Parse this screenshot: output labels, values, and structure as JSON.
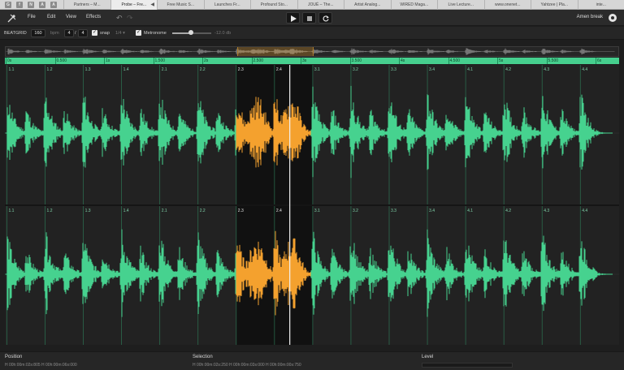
{
  "browser": {
    "pinned": [
      "G",
      "f",
      "N",
      "A",
      "A"
    ],
    "tabs": [
      {
        "label": "Partners – M...",
        "active": false
      },
      {
        "label": "Probe – Fre...",
        "active": true
      },
      {
        "label": "Free Music S...",
        "active": false
      },
      {
        "label": "Launches Fr...",
        "active": false
      },
      {
        "label": "Profound Sto...",
        "active": false
      },
      {
        "label": "JOUÉ – The...",
        "active": false
      },
      {
        "label": "Artist Analog...",
        "active": false
      },
      {
        "label": "WIRED Maga...",
        "active": false
      },
      {
        "label": "Live Lecture...",
        "active": false
      },
      {
        "label": "www.onenet...",
        "active": false
      },
      {
        "label": "Yahtzee | Pla...",
        "active": false
      },
      {
        "label": "inte...",
        "active": false
      }
    ]
  },
  "menubar": {
    "menus": [
      "File",
      "Edit",
      "View",
      "Effects"
    ],
    "title": "Amen break"
  },
  "toolbar": {
    "beatgrid_label": "BEATGRID",
    "bpm_value": "160",
    "bpm_unit": "bpm",
    "sig_num": "4",
    "sig_sep": "/",
    "sig_den": "4",
    "snap_check": "✓",
    "snap_label": "snap",
    "snap_value": "1/4 ▾",
    "metro_check": "✓",
    "metronome_label": "Metronome",
    "volume_value": "-12.0 db",
    "volume_fraction": 0.48
  },
  "ruler": {
    "labels": [
      "0s",
      "0.500",
      "1s",
      "1.500",
      "2s",
      "2.500",
      "3s",
      "3.500",
      "4s",
      "4.500",
      "5s",
      "5.500",
      "6s"
    ]
  },
  "beats": [
    "1.1",
    "1.2",
    "1.3",
    "1.4",
    "2.1",
    "2.2",
    "2.3",
    "2.4",
    "3.1",
    "3.2",
    "3.3",
    "3.4",
    "4.1",
    "4.2",
    "4.3",
    "4.4"
  ],
  "selection_beats": {
    "start": 6,
    "end": 8
  },
  "playhead_beat": 7.4,
  "colors": {
    "waveform": "#46d28f",
    "selection_wave": "#f4a12e",
    "accent": "#46cf8e"
  },
  "status": {
    "position_label": "Position",
    "position_value": "H 00h:00m:02s:805   H 00h:00m:06s:000",
    "selection_label": "Selection",
    "selection_value": "H 00h:00m:02s:250   H 00h:00m:03s:000   H 00h:00m:00s:750",
    "level_label": "Level"
  }
}
